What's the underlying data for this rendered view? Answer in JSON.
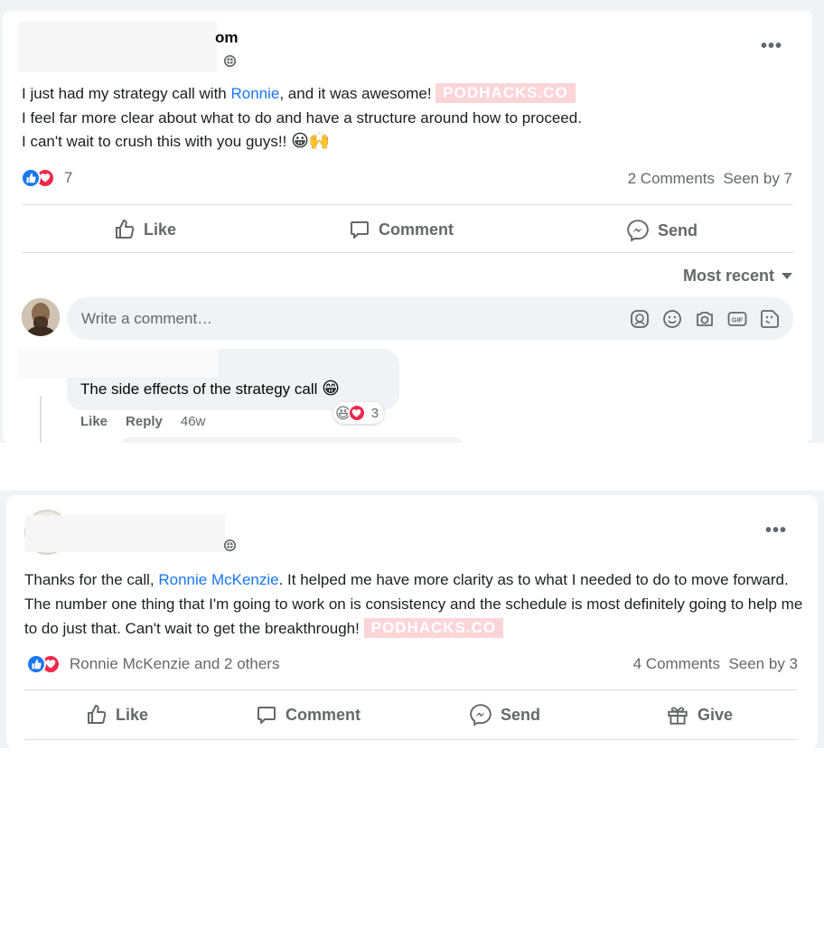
{
  "post1": {
    "author_suffix": "om",
    "body": {
      "line1_pre": "I just had my strategy call with ",
      "line1_link": "Ronnie",
      "line1_post": ", and it was awesome!",
      "watermark": "PODHACKS.CO",
      "line2": "I feel far more clear about what to do and have a structure around how to proceed.",
      "line3": "I can't wait to crush this with you guys!!",
      "line3_emojis": "😀🙌"
    },
    "reaction_count": "7",
    "comments_count": "2 Comments",
    "seen_by": "Seen by 7",
    "actions": {
      "like": "Like",
      "comment": "Comment",
      "send": "Send"
    },
    "sort_label": "Most recent",
    "comment_placeholder": "Write a comment…",
    "comment": {
      "text": "The side effects of the strategy call",
      "text_emoji": "😁",
      "like": "Like",
      "reply": "Reply",
      "time": "46w",
      "reaction_emoji": "😆",
      "reaction_count": "3"
    }
  },
  "post2": {
    "body": {
      "pre": "Thanks for the call, ",
      "link": "Ronnie McKenzie",
      "post": ". It helped me have more clarity as to what I needed to do to move forward. The number one thing that I'm going to work on is consistency and the schedule is most definitely going to help me to do just that. Can't wait to get the breakthrough!",
      "watermark": "PODHACKS.CO"
    },
    "reaction_names": "Ronnie McKenzie and 2 others",
    "comments_count": "4 Comments",
    "seen_by": "Seen by 3",
    "actions": {
      "like": "Like",
      "comment": "Comment",
      "send": "Send",
      "give": "Give"
    }
  },
  "colors": {
    "link": "#1877f2",
    "secondary_text": "#65676b",
    "like_blue": "#1877f2",
    "love_red": "#f0284a",
    "watermark_pink": "#fbd5d8"
  }
}
